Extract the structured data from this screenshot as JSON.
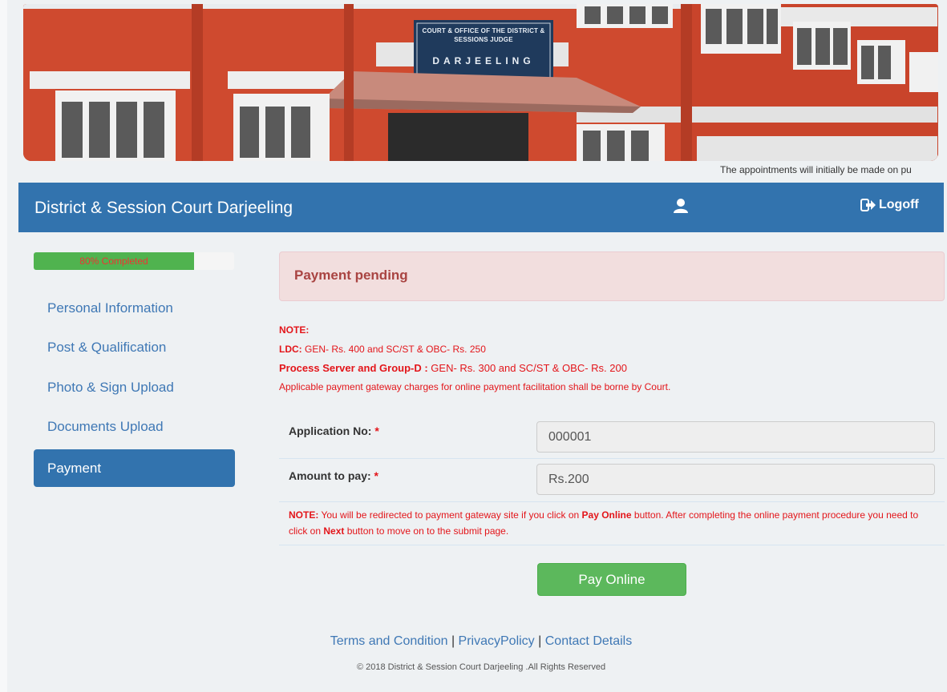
{
  "banner": {
    "sign_line1": "COURT & OFFICE OF THE DISTRICT & SESSIONS JUDGE",
    "sign_line2": "DARJEELING"
  },
  "ticker": {
    "text": "The appointments will initially be made on pu"
  },
  "navbar": {
    "brand": "District & Session Court Darjeeling",
    "user_icon": "user-icon",
    "logoff_icon": "sign-out-icon",
    "logoff_label": "Logoff",
    "color": "#3273ae"
  },
  "progress": {
    "label": "80% Completed",
    "percent": 80
  },
  "sidebar": {
    "items": [
      {
        "label": "Personal Information",
        "active": false
      },
      {
        "label": "Post & Qualification",
        "active": false
      },
      {
        "label": "Photo & Sign Upload",
        "active": false
      },
      {
        "label": "Documents Upload",
        "active": false
      },
      {
        "label": "Payment",
        "active": true
      }
    ]
  },
  "alert": {
    "text": "Payment pending"
  },
  "notes": {
    "heading": "NOTE:",
    "ldc_label": "LDC:",
    "ldc_text": " GEN- Rs. 400 and SC/ST & OBC- Rs. 250",
    "ps_label": "Process Server and Group-D :",
    "ps_text": " GEN- Rs. 300 and SC/ST & OBC- Rs. 200",
    "charges": "Applicable payment gateway charges for online payment facilitation shall be borne by Court."
  },
  "form": {
    "application_no_label": "Application No:",
    "application_no_value": "000001",
    "amount_label": "Amount to pay:",
    "amount_value": "Rs.200",
    "required_mark": "*"
  },
  "redirect_note": {
    "label": "NOTE:",
    "part1": " You will be redirected to payment gateway site if you click on ",
    "pay_online": "Pay Online",
    "part2": " button. After completing the online payment procedure you need to click on ",
    "next": "Next",
    "part3": " button to move on to the submit page."
  },
  "pay_button": {
    "label": "Pay Online"
  },
  "footer": {
    "terms": "Terms and Condition",
    "privacy": "PrivacyPolicy",
    "contact": "Contact Details",
    "separator": " | ",
    "copyright": "© 2018 District & Session Court Darjeeling .All Rights Reserved"
  }
}
